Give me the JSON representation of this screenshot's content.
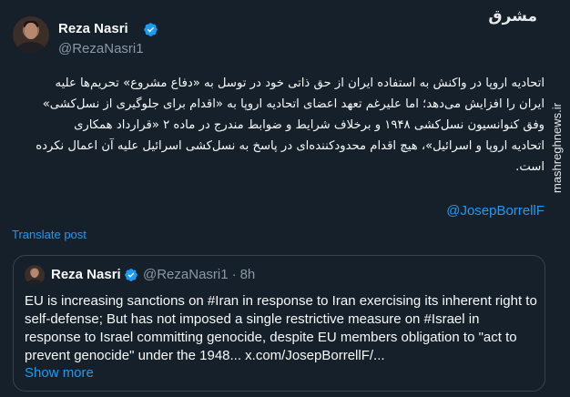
{
  "author": {
    "name": "Reza Nasri",
    "handle": "@RezaNasri1",
    "verified_color": "#1d9bf0"
  },
  "watermark": {
    "logo": "مشرق",
    "site": "mashreghnews.ir"
  },
  "post": {
    "lines": [
      "اتحادیه اروپا در واکنش به استفاده ایران از حق ذاتی خود در توسل به «دفاع مشروع» تحریم‌ها علیه",
      "ایران را افزایش می‌دهد؛ اما علیرغم تعهد اعضای اتحادیه اروپا به «اقدام برای جلوگیری از نسل‌کشی»",
      "وفق کنوانسیون نسل‌کشی ۱۹۴۸ و برخلاف شرایط و ضوابط مندرج در ماده ۲ «قرارداد همکاری",
      "اتحادیه اروپا و اسرائیل»، هیچ اقدام محدودکننده‌ای در پاسخ به نسل‌کشی اسرائیل علیه آن اعمال نکرده",
      "است."
    ],
    "mention": "@JosepBorrellF",
    "translate_label": "Translate post"
  },
  "quote": {
    "name": "Reza Nasri",
    "handle": "@RezaNasri1",
    "separator": "·",
    "time": "8h",
    "text": "EU is increasing sanctions on #Iran in response to Iran exercising its inherent right to self-defense; But has not imposed a single restrictive measure on #Israel in response to Israel committing genocide, despite EU members obligation to \"act to prevent genocide\" under the 1948... x.com/JosepBorrellF/...",
    "show_more": "Show more"
  },
  "colors": {
    "background": "#15202b",
    "link": "#1d9bf0",
    "secondary_text": "#8b98a5",
    "border": "#38444d"
  }
}
